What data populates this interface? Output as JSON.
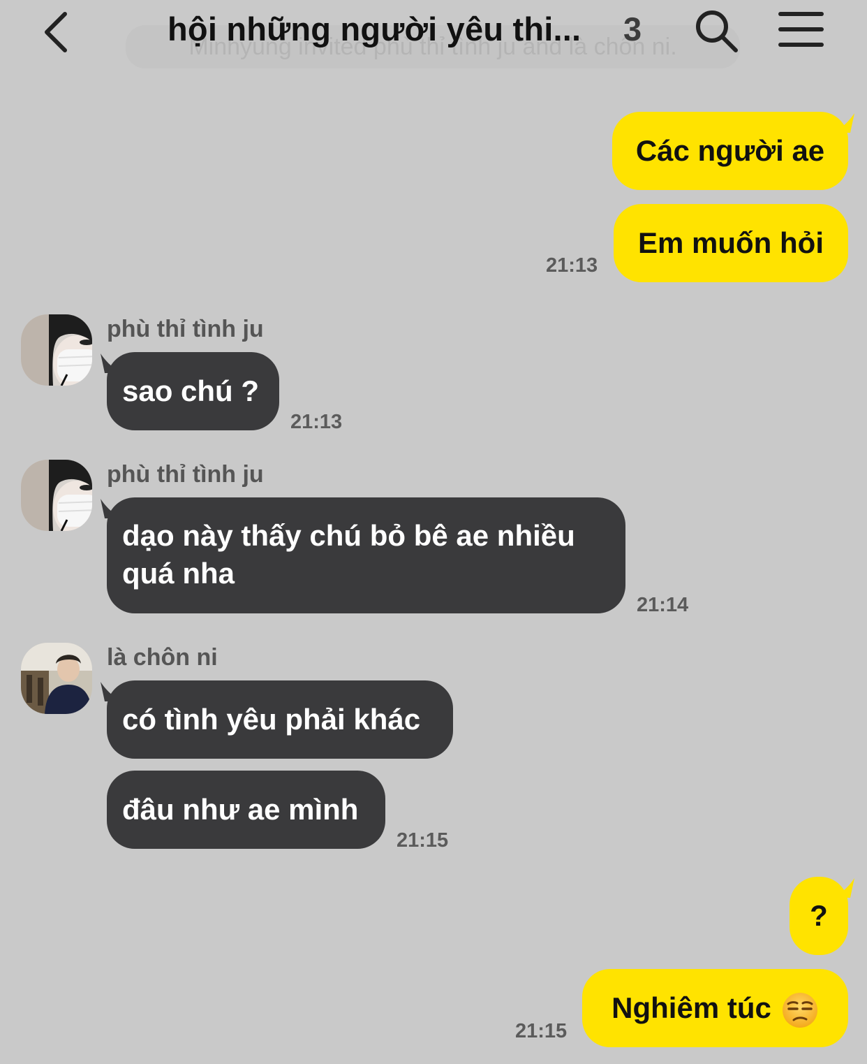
{
  "header": {
    "title": "hội những người yêu thi...",
    "member_count": "3",
    "notice": "Minhyung invited phù thỉ tình ju and là chôn ni."
  },
  "messages": [
    {
      "sender": "me",
      "text": "Các người ae"
    },
    {
      "sender": "me",
      "text": "Em muốn hỏi",
      "time": "21:13"
    },
    {
      "sender": "phù thỉ tình ju",
      "text": "sao chú ?",
      "time": "21:13"
    },
    {
      "sender": "phù thỉ tình ju",
      "text_line1": "dạo này thấy chú bỏ bê ae nhiều",
      "text_line2": "quá nha",
      "time": "21:14"
    },
    {
      "sender": "là chôn ni",
      "text": "có tình yêu phải khác"
    },
    {
      "sender": "là chôn ni",
      "text": "đâu như ae mình",
      "time": "21:15"
    },
    {
      "sender": "me",
      "text": "?"
    },
    {
      "sender": "me",
      "text": "Nghiêm túc",
      "emoji": "unamused-face",
      "time": "21:15"
    }
  ],
  "colors": {
    "background": "#c9c9c9",
    "my_bubble": "#ffe300",
    "other_bubble": "#3a3a3c"
  }
}
